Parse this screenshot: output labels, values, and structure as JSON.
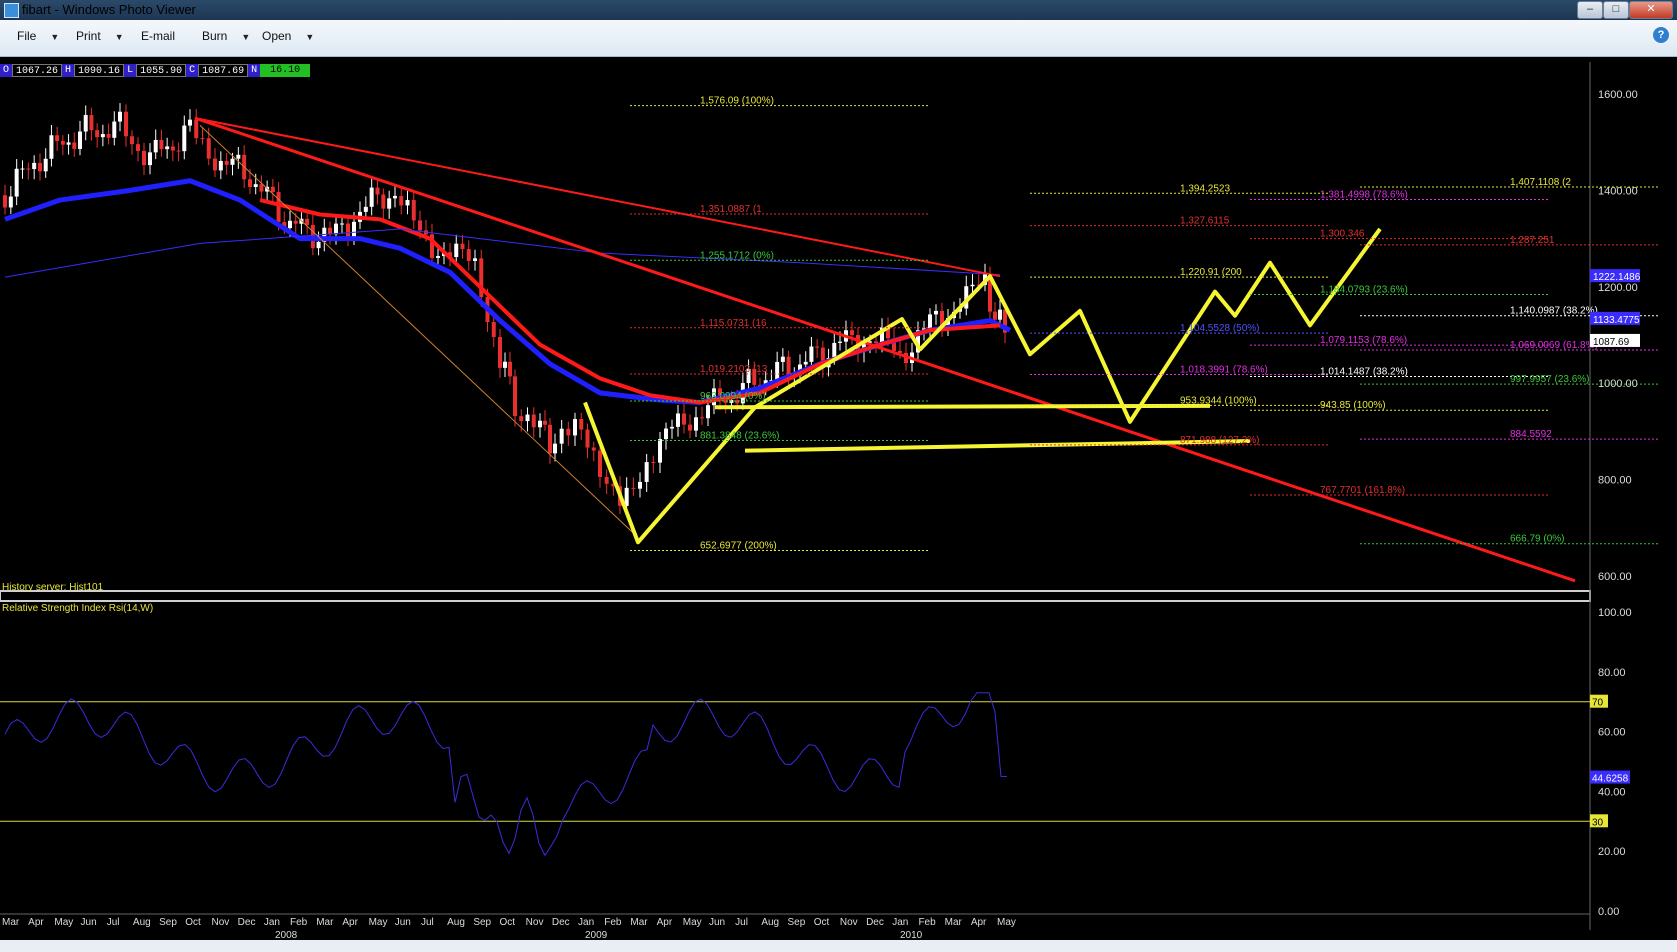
{
  "window": {
    "title": "fibart - Windows Photo Viewer",
    "minimize": "–",
    "maximize": "□",
    "close": "✕"
  },
  "menu": {
    "items": [
      "File",
      "Print",
      "E-mail",
      "Burn",
      "Open"
    ],
    "help": "?"
  },
  "ohlc": {
    "o_label": "O",
    "open": "1067.26",
    "h_label": "H",
    "high": "1090.16",
    "l_label": "L",
    "low": "1055.90",
    "c_label": "C",
    "close": "1087.69",
    "n_label": "N",
    "net": "16.10"
  },
  "panes": {
    "history_server": "History server: Hist101",
    "rsi_title": "Relative Strength Index Rsi(14,W)"
  },
  "colors": {
    "candle_up": "#ffffff",
    "candle_down": "#e83030",
    "ema_red": "#ff1a1a",
    "ema_blue": "#3a2cff",
    "trend": "#ff1a1a",
    "harmonic": "#f5f533",
    "rsi": "#3a2cdd",
    "rsi_level": "#d8d840"
  },
  "chart_data": {
    "type": "line",
    "price_axis": {
      "ticks": [
        "1600.00",
        "1400.00",
        "1200.00",
        "1000.00",
        "800.00",
        "600.00"
      ],
      "ylim": [
        560,
        1650
      ]
    },
    "rsi_axis": {
      "ticks": [
        "100.00",
        "80.00",
        "60.00",
        "40.00",
        "20.00",
        "0.00"
      ],
      "levels": [
        "70",
        "30"
      ],
      "current": "44.6258"
    },
    "price_markers": [
      "1222.1486",
      "1133.4775",
      "1087.69"
    ],
    "x_months": [
      "Mar",
      "Apr",
      "May",
      "Jun",
      "Jul",
      "Aug",
      "Sep",
      "Oct",
      "Nov",
      "Dec",
      "Jan",
      "Feb",
      "Mar",
      "Apr",
      "May",
      "Jun",
      "Jul",
      "Aug",
      "Sep",
      "Oct",
      "Nov",
      "Dec",
      "Jan",
      "Feb",
      "Mar",
      "Apr",
      "May",
      "Jun",
      "Jul",
      "Aug",
      "Sep",
      "Oct",
      "Nov",
      "Dec",
      "Jan",
      "Feb",
      "Mar",
      "Apr",
      "May"
    ],
    "x_years": [
      "2008",
      "2009",
      "2010"
    ],
    "fib_labels": [
      {
        "t": "1,576.09 (100%)",
        "c": "#e6e63a",
        "v": 1576
      },
      {
        "t": "1,394.2523",
        "c": "#e6e63a",
        "v": 1394
      },
      {
        "t": "1,381.4998 (78.6%)",
        "c": "#e030e0",
        "v": 1381
      },
      {
        "t": "1,407.1108 (2",
        "c": "#e6e63a",
        "v": 1407
      },
      {
        "t": "1,351.0887 (1",
        "c": "#e03030",
        "v": 1351
      },
      {
        "t": "1,327.6115",
        "c": "#e03030",
        "v": 1327
      },
      {
        "t": "1,300.346",
        "c": "#e03030",
        "v": 1300
      },
      {
        "t": "1,287.251",
        "c": "#e03030",
        "v": 1287
      },
      {
        "t": "1,255.1712 (0%)",
        "c": "#3ac83a",
        "v": 1255
      },
      {
        "t": "1,220.91 (200",
        "c": "#e6e63a",
        "v": 1220
      },
      {
        "t": "1,184.0793 (23.6%)",
        "c": "#3ac83a",
        "v": 1184
      },
      {
        "t": "1,140.0987 (38.2%)",
        "c": "#ffffff",
        "v": 1140
      },
      {
        "t": "1,115.0731 (16",
        "c": "#e03030",
        "v": 1115
      },
      {
        "t": "1,104.5528 (50%)",
        "c": "#5050ff",
        "v": 1104
      },
      {
        "t": "1,079.1153 (78.6%)",
        "c": "#e030e0",
        "v": 1079
      },
      {
        "t": "1,069.0069 (61.8%)",
        "c": "#e030e0",
        "v": 1069
      },
      {
        "t": "1,019.2103 (13",
        "c": "#e03030",
        "v": 1019
      },
      {
        "t": "1,018.3991 (78.6%)",
        "c": "#e030e0",
        "v": 1018
      },
      {
        "t": "1,014.1487 (38.2%)",
        "c": "#ffffff",
        "v": 1014
      },
      {
        "t": "997.9957 (23.6%)",
        "c": "#3ac83a",
        "v": 998
      },
      {
        "t": "963.0994 (0%)",
        "c": "#3ac83a",
        "v": 963
      },
      {
        "t": "953.9344 (100%)",
        "c": "#e6e63a",
        "v": 954
      },
      {
        "t": "943.85 (100%)",
        "c": "#e6e63a",
        "v": 944
      },
      {
        "t": "884.5592",
        "c": "#e030e0",
        "v": 884
      },
      {
        "t": "881.3848 (23.6%)",
        "c": "#3ac83a",
        "v": 881
      },
      {
        "t": "871.988 (127.2%)",
        "c": "#e03030",
        "v": 872
      },
      {
        "t": "767.7701 (161.8%)",
        "c": "#e03030",
        "v": 768
      },
      {
        "t": "666.79 (0%)",
        "c": "#3ac83a",
        "v": 667
      },
      {
        "t": "652.6977 (200%)",
        "c": "#e6e63a",
        "v": 653
      }
    ]
  }
}
